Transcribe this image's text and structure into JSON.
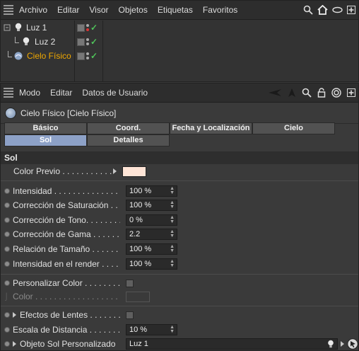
{
  "object_manager": {
    "menu": [
      "Archivo",
      "Editar",
      "Visor",
      "Objetos",
      "Etiquetas",
      "Favoritos"
    ],
    "objects": [
      {
        "name": "Luz 1",
        "icon": "light-bulb-icon",
        "selected": false
      },
      {
        "name": "Luz 2",
        "icon": "light-bulb-icon",
        "selected": false
      },
      {
        "name": "Cielo Físico",
        "icon": "sky-sphere-icon",
        "selected": true
      }
    ]
  },
  "attribute_manager": {
    "menu": [
      "Modo",
      "Editar",
      "Datos de Usuario"
    ],
    "object_title": "Cielo Físico [Cielo Físico]",
    "tabs_row1": [
      "Básico",
      "Coord.",
      "Fecha y Localización",
      "Cielo"
    ],
    "tabs_row2": [
      "Sol",
      "Detalles"
    ],
    "active_tab": "Sol",
    "section": "Sol",
    "color_previo_label": "Color Previo . . . . . . . . . . .",
    "color_previo_value": "#fee4d6",
    "params": [
      {
        "label": "Intensidad . . . . . . . . . . . . . . . . .",
        "value": "100 %"
      },
      {
        "label": "Corrección de Saturación . . . . . .",
        "value": "100 %"
      },
      {
        "label": "Corrección de Tono. . . . . . . . . .",
        "value": "0 %"
      },
      {
        "label": "Corrección de Gama . . . . . . . .",
        "value": "2.2"
      },
      {
        "label": "Relación de Tamaño . . . . . . . .",
        "value": "100 %"
      },
      {
        "label": "Intensidad en el render  . . . . . .",
        "value": "100 %"
      }
    ],
    "personalizar_color_label": "Personalizar Color . . . . . . . . . .",
    "color_label": "Color . . . . . . . . . . . . . . . . . .",
    "efectos_lentes_label": "Efectos de Lentes . . . . . . .",
    "escala_distancia_label": "Escala de Distancia . . . . . . . . .",
    "escala_distancia_value": "10 %",
    "objeto_sol_label": "Objeto Sol Personalizado",
    "objeto_sol_value": "Luz 1"
  },
  "colors": {
    "selected_text": "#f0a800",
    "active_tab": "#8da1c7",
    "check_green": "#4fc35a"
  }
}
